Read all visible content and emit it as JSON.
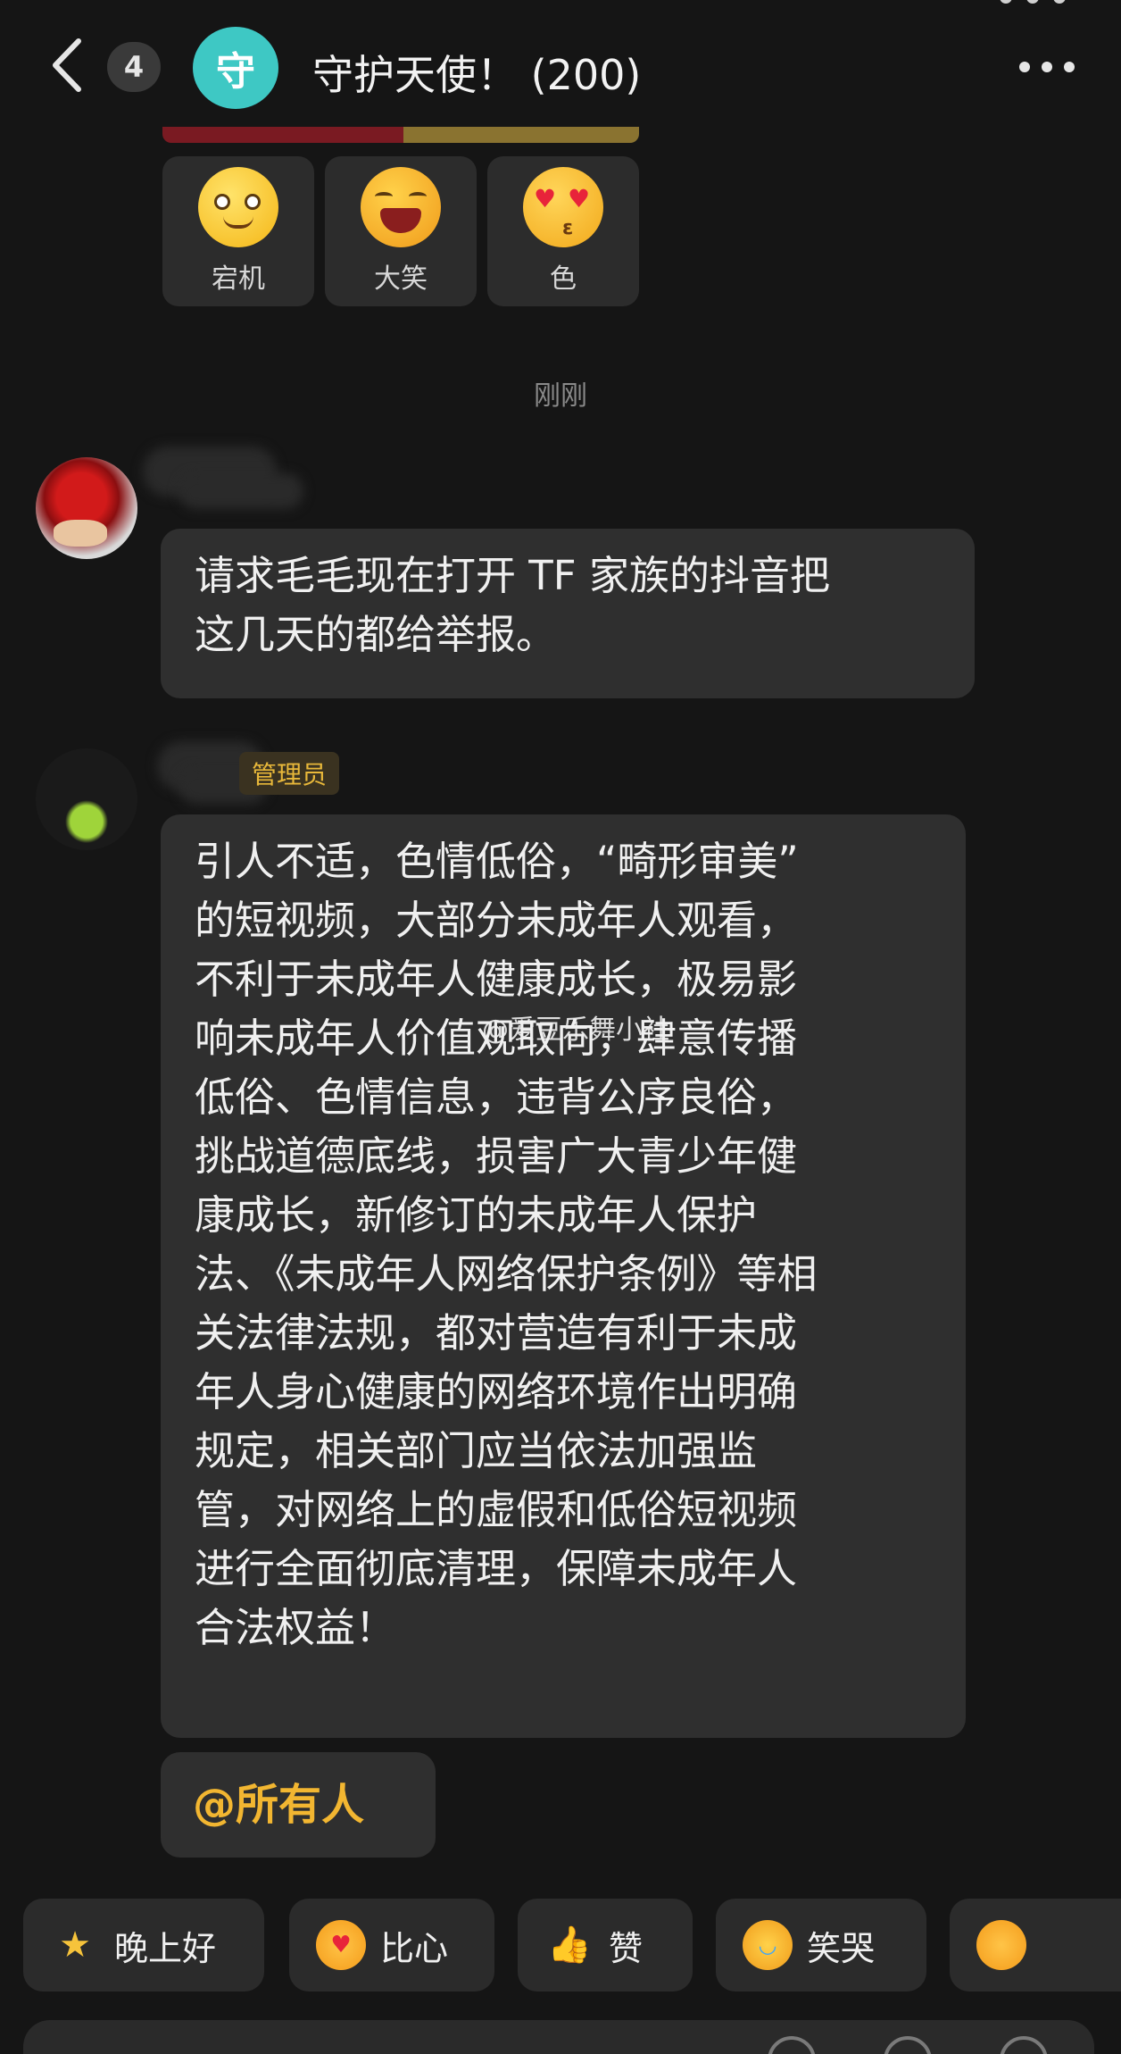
{
  "header": {
    "unread_count": "4",
    "group_avatar_char": "守",
    "group_title": "守护天使！ (200)"
  },
  "reactions": [
    {
      "label": "宕机",
      "icon": "dizzy-face-icon"
    },
    {
      "label": "大笑",
      "icon": "laughing-face-icon"
    },
    {
      "label": "色",
      "icon": "heart-eyes-face-icon"
    }
  ],
  "timestamp": "刚刚",
  "messages": [
    {
      "sender_avatar": "roses-avatar",
      "lines": [
        "请求毛毛现在打开 TF 家族的抖音把",
        "这几天的都给举报。"
      ]
    },
    {
      "sender_avatar": "person-avatar",
      "role_badge": "管理员",
      "lines": [
        "引人不适，色情低俗，“畸形审美”",
        "的短视频，大部分未成年人观看，",
        "不利于未成年人健康成长，极易影",
        "响未成年人价值观取向，肆意传播",
        "低俗、色情信息，违背公序良俗，",
        "挑战道德底线，损害广大青少年健",
        "康成长，新修订的未成年人保护",
        "法、《未成年人网络保护条例》等相",
        "关法律法规，都对营造有利于未成",
        "年人身心健康的网络环境作出明确",
        "规定，相关部门应当依法加强监",
        "管，对网络上的虚假和低俗短视频",
        "进行全面彻底清理，保障未成年人",
        "合法权益！"
      ],
      "mention": "@所有人"
    }
  ],
  "watermark": "@爱豆乐舞小社",
  "quick_replies": [
    {
      "label": "晚上好",
      "icon": "star-face-icon"
    },
    {
      "label": "比心",
      "icon": "heart-hands-icon"
    },
    {
      "label": "赞",
      "icon": "thumbs-up-icon"
    },
    {
      "label": "笑哭",
      "icon": "tears-of-joy-icon"
    },
    {
      "label": "",
      "icon": "cat-face-icon"
    }
  ]
}
